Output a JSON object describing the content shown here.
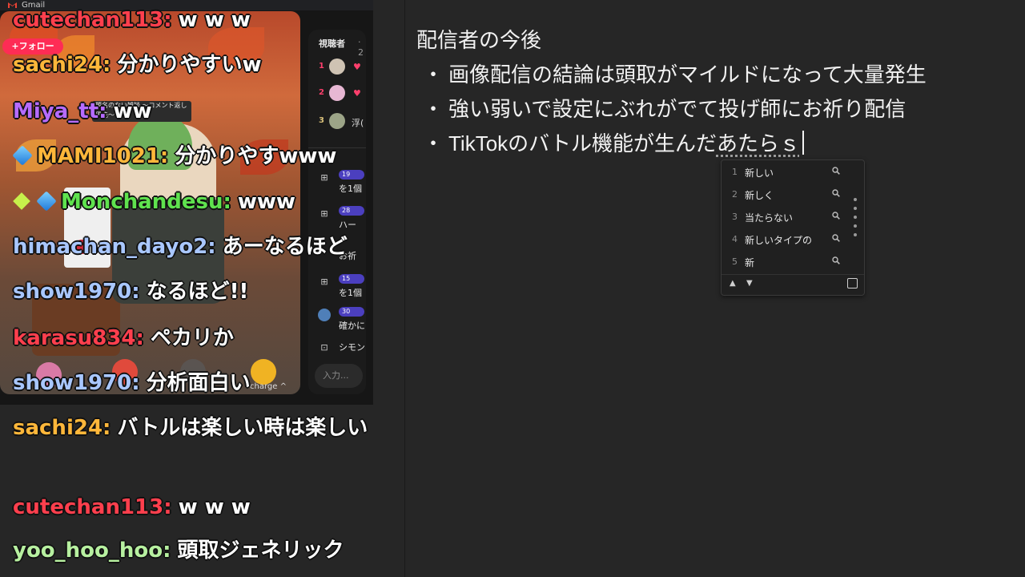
{
  "window": {
    "gmail_label": "Gmail"
  },
  "stream": {
    "follow_label": "+フォロー",
    "title_card": "題名のない雑談 〜コメント返し優先〜",
    "charge_label": "charge ^",
    "viewers_title": "視聴者",
    "viewers_count": "· 2",
    "ranking": [
      {
        "rank": "1",
        "extra": "♥"
      },
      {
        "rank": "2",
        "extra": "♥"
      },
      {
        "rank": "3",
        "extra": "浮("
      }
    ],
    "events": [
      {
        "badge": "19",
        "text": "を1個"
      },
      {
        "badge": "28",
        "text": "ハー"
      },
      {
        "badge": "",
        "text": "お祈"
      },
      {
        "badge": "15",
        "text": "を1個"
      },
      {
        "badge": "30",
        "text": "確かに"
      },
      {
        "badge": "",
        "text": "シモン"
      }
    ],
    "input_placeholder": "入力..."
  },
  "chat": [
    {
      "user": "cutechan113:",
      "text": "w w w",
      "color": "#ff3f4d"
    },
    {
      "user": "sachi24:",
      "text": "分かりやすいw",
      "color": "#ffb73a"
    },
    {
      "user": "Miya_tt:",
      "text": "ww",
      "color": "#b66bff"
    },
    {
      "user": "MAMI1021:",
      "text": "分かりやすwww",
      "color": "#ffb73a",
      "badge": "cube"
    },
    {
      "user": "Monchandesu:",
      "text": "www",
      "color": "#5fe24e",
      "badge": "diamond+cube"
    },
    {
      "user": "himachan_dayo2:",
      "text": "あーなるほど",
      "color": "#a9c7ff"
    },
    {
      "user": "show1970:",
      "text": "なるほど!!",
      "color": "#a9c7ff"
    },
    {
      "user": "karasu834:",
      "text": "ペカリか",
      "color": "#ff3f4d"
    },
    {
      "user": "show1970:",
      "text": "分析面白い",
      "color": "#a9c7ff"
    },
    {
      "user": "sachi24:",
      "text": "バトルは楽しい時は楽しい",
      "color": "#ffb73a"
    },
    {
      "user": "cutechan113:",
      "text": "w w w",
      "color": "#ff3f4d"
    },
    {
      "user": "yoo_hoo_hoo:",
      "text": "頭取ジェネリック",
      "color": "#b7f0a0"
    }
  ],
  "notes": {
    "title": "配信者の今後",
    "bullet_char": "・",
    "bullets": [
      "画像配信の結論は頭取がマイルドになって大量発生",
      "強い弱いで設定にぶれがでて投げ師にお祈り配信"
    ],
    "bullet3_prefix": "TikTokのバトル機能が生んだ",
    "bullet3_composing": "あたらｓ"
  },
  "ime": {
    "candidates": [
      {
        "num": "1",
        "text": "新しい"
      },
      {
        "num": "2",
        "text": "新しく"
      },
      {
        "num": "3",
        "text": "当たらない"
      },
      {
        "num": "4",
        "text": "新しいタイプの"
      },
      {
        "num": "5",
        "text": "新"
      }
    ]
  }
}
